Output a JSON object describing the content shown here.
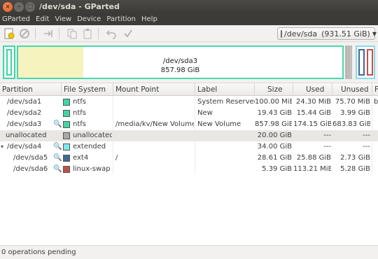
{
  "window": {
    "title": "/dev/sda - GParted",
    "close_glyph": "×",
    "min_glyph": "–",
    "max_glyph": "□"
  },
  "menu": [
    "GParted",
    "Edit",
    "View",
    "Device",
    "Partition",
    "Help"
  ],
  "toolbar": {
    "icons": [
      "new-partition",
      "delete",
      "resize-move",
      "copy",
      "paste",
      "undo",
      "apply"
    ],
    "device": "/dev/sda",
    "device_size": "(931.51 GiB)"
  },
  "diskmap": {
    "label_name": "/dev/sda3",
    "label_size": "857.98 GiB",
    "sda3_used_fraction": 0.2,
    "colors": {
      "ntfs": "#42d4a6",
      "unallocated": "#a9a9a9",
      "extended": "#7fe8f2",
      "ext4": "#3d6a9a",
      "linux_swap": "#c0504d",
      "used": "#f6f3bf"
    }
  },
  "table": {
    "columns": [
      "Partition",
      "File System",
      "Mount Point",
      "Label",
      "Size",
      "Used",
      "Unused",
      "F"
    ],
    "rows": [
      {
        "partition": "/dev/sda1",
        "fs": "ntfs",
        "fs_color": "#42d4a6",
        "mount": "",
        "label": "System Reserved",
        "size": "100.00 MiB",
        "used": "24.30 MiB",
        "unused": "75.70 MiB",
        "flags": "b",
        "key": false,
        "expander": "",
        "indent": false,
        "selected": false
      },
      {
        "partition": "/dev/sda2",
        "fs": "ntfs",
        "fs_color": "#42d4a6",
        "mount": "",
        "label": "New",
        "size": "19.43 GiB",
        "used": "15.44 GiB",
        "unused": "3.99 GiB",
        "flags": "",
        "key": false,
        "expander": "",
        "indent": false,
        "selected": false
      },
      {
        "partition": "/dev/sda3",
        "fs": "ntfs",
        "fs_color": "#42d4a6",
        "mount": "/media/kv/New Volume",
        "label": "New Volume",
        "size": "857.98 GiB",
        "used": "174.15 GiB",
        "unused": "683.83 GiB",
        "flags": "",
        "key": true,
        "expander": "",
        "indent": false,
        "selected": false
      },
      {
        "partition": "unallocated",
        "fs": "unallocated",
        "fs_color": "#a9a9a9",
        "mount": "",
        "label": "",
        "size": "20.00 GiB",
        "used": "---",
        "unused": "---",
        "flags": "",
        "key": false,
        "expander": "",
        "indent": false,
        "selected": true
      },
      {
        "partition": "/dev/sda4",
        "fs": "extended",
        "fs_color": "#7fe8f2",
        "mount": "",
        "label": "",
        "size": "34.00 GiB",
        "used": "---",
        "unused": "---",
        "flags": "",
        "key": true,
        "expander": "▾",
        "indent": false,
        "selected": false
      },
      {
        "partition": "/dev/sda5",
        "fs": "ext4",
        "fs_color": "#3d6a9a",
        "mount": "/",
        "label": "",
        "size": "28.61 GiB",
        "used": "25.88 GiB",
        "unused": "2.73 GiB",
        "flags": "",
        "key": true,
        "expander": "",
        "indent": true,
        "selected": false
      },
      {
        "partition": "/dev/sda6",
        "fs": "linux-swap",
        "fs_color": "#c0504d",
        "mount": "",
        "label": "",
        "size": "5.39 GiB",
        "used": "113.21 MiB",
        "unused": "5.28 GiB",
        "flags": "",
        "key": true,
        "expander": "",
        "indent": true,
        "selected": false
      }
    ]
  },
  "status": "0 operations pending"
}
